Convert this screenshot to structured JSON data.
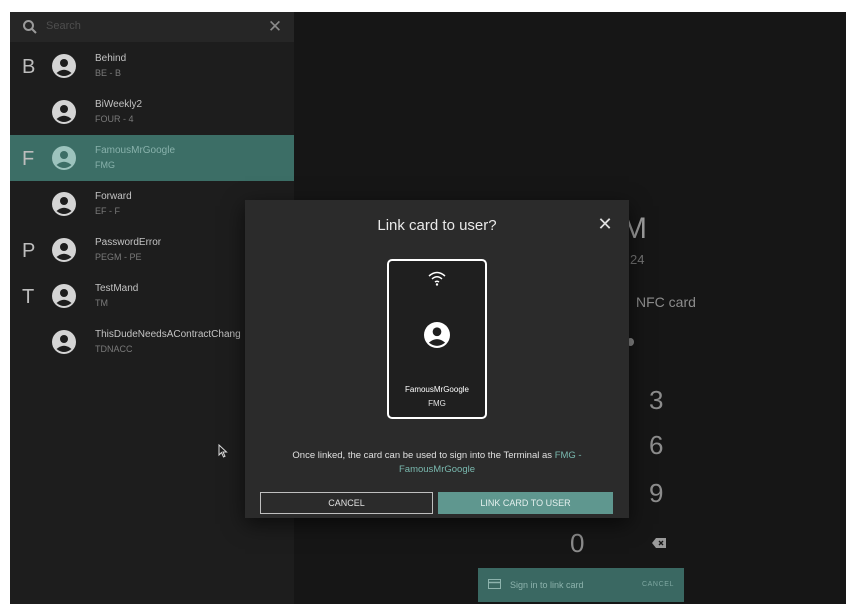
{
  "search": {
    "placeholder": "Search",
    "clear_icon": "close-icon"
  },
  "users": [
    {
      "letter": "B",
      "name": "Behind",
      "code": "BE - B",
      "selected": false
    },
    {
      "letter": "",
      "name": "BiWeekly2",
      "code": "FOUR - 4",
      "selected": false
    },
    {
      "letter": "F",
      "name": "FamousMrGoogle",
      "code": "FMG",
      "selected": true
    },
    {
      "letter": "",
      "name": "Forward",
      "code": "EF - F",
      "selected": false
    },
    {
      "letter": "P",
      "name": "PasswordError",
      "code": "PEGM - PE",
      "selected": false
    },
    {
      "letter": "T",
      "name": "TestMand",
      "code": "TM",
      "selected": false
    },
    {
      "letter": "",
      "name": "ThisDudeNeedsAContractChang",
      "code": "TDNACC",
      "selected": false
    }
  ],
  "background": {
    "clock_fragment": "M",
    "date_fragment": "24",
    "nfc_fragment": "NFC card",
    "keypad": [
      "3",
      "6",
      "9",
      "0"
    ],
    "backspace_icon": "backspace-icon",
    "sign_in_label": "Sign in to link card",
    "sign_in_cancel": "CANCEL",
    "card_icon": "card-icon"
  },
  "dialog": {
    "title": "Link card to user?",
    "close_icon": "close-icon",
    "card": {
      "name": "FamousMrGoogle",
      "code": "FMG",
      "wifi_icon": "nfc-icon",
      "avatar_icon": "user-avatar-icon"
    },
    "message_prefix": "Once linked, the card can be used to sign into the Terminal as ",
    "message_highlight": "FMG - FamousMrGoogle",
    "cancel_label": "CANCEL",
    "confirm_label": "LINK CARD TO USER"
  },
  "colors": {
    "accent": "#5f978f",
    "selected_row": "#3c6e66",
    "highlight_text": "#79b8ae",
    "dialog_bg": "#2b2b2b"
  }
}
